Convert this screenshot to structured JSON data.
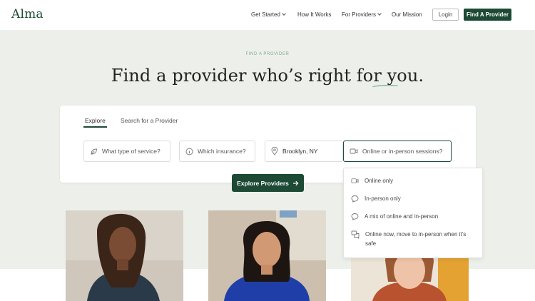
{
  "brand": {
    "logo_text": "Alma",
    "accent": "#1d4a35"
  },
  "nav": {
    "links": [
      {
        "label": "Get Started",
        "has_dropdown": true
      },
      {
        "label": "How It Works",
        "has_dropdown": false
      },
      {
        "label": "For Providers",
        "has_dropdown": true
      },
      {
        "label": "Our Mission",
        "has_dropdown": false
      }
    ],
    "login_label": "Login",
    "cta_label": "Find A Provider"
  },
  "hero": {
    "eyebrow": "FIND A PROVIDER",
    "headline": "Find a provider who’s right for you."
  },
  "search": {
    "tabs": [
      {
        "label": "Explore",
        "active": true
      },
      {
        "label": "Search for a Provider",
        "active": false
      }
    ],
    "fields": {
      "service": {
        "placeholder": "What type of service?",
        "icon": "leaf-icon"
      },
      "insurance": {
        "placeholder": "Which insurance?",
        "icon": "info-circle-icon"
      },
      "location": {
        "value": "Brooklyn, NY",
        "icon": "map-pin-icon"
      },
      "session": {
        "placeholder": "Online or in-person sessions?",
        "icon": "video-camera-icon"
      }
    },
    "explore_button": "Explore Providers"
  },
  "session_dropdown": {
    "options": [
      {
        "label": "Online only",
        "icon": "video-camera-icon"
      },
      {
        "label": "In-person only",
        "icon": "speech-bubble-icon"
      },
      {
        "label": "A mix of online and in-person",
        "icon": "speech-bubble-icon"
      },
      {
        "label": "Online now, move to in-person when it’s safe",
        "icon": "chat-bubbles-icon"
      }
    ]
  },
  "providers": {
    "photos": [
      {
        "icon": "provider-photo"
      },
      {
        "icon": "provider-photo"
      },
      {
        "icon": "provider-photo"
      }
    ]
  }
}
